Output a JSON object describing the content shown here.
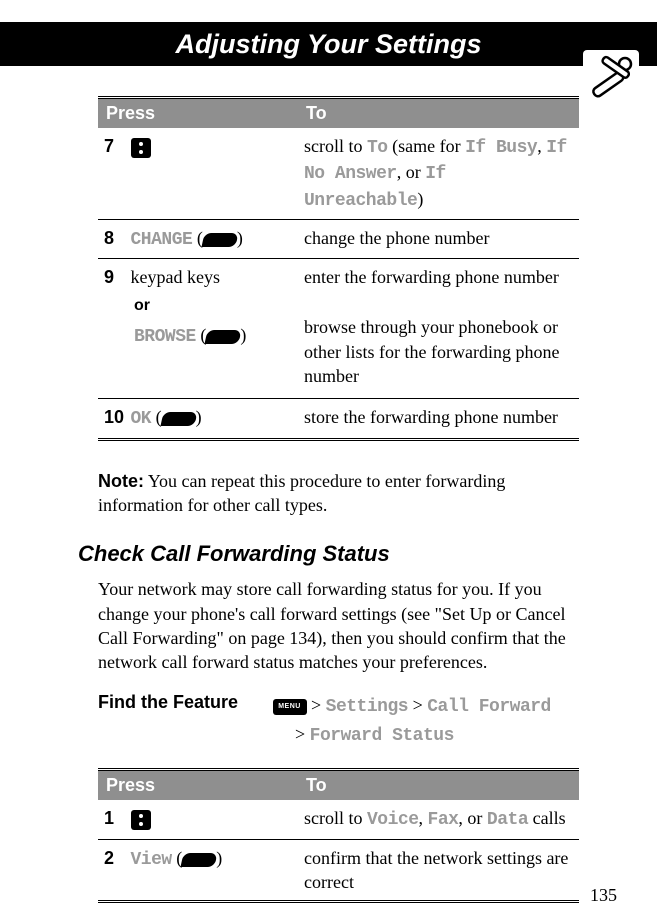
{
  "header": {
    "title": "Adjusting Your Settings"
  },
  "table1": {
    "head_press": "Press",
    "head_to": "To",
    "rows": {
      "r7": {
        "num": "7",
        "to_pre": "scroll to ",
        "to_a": "To",
        "to_mid1": " (same for ",
        "to_b": "If Busy",
        "to_mid2": ", ",
        "to_c": "If No Answer",
        "to_mid3": ", or ",
        "to_d": "If Unreachable",
        "to_post": ")"
      },
      "r8": {
        "num": "8",
        "label": "CHANGE",
        "paren_open": " (",
        "paren_close": ")",
        "to": "change the phone number"
      },
      "r9": {
        "num": "9",
        "press_a": "keypad keys",
        "or": "or",
        "label_b": "BROWSE",
        "paren_open": " (",
        "paren_close": ")",
        "to_a": "enter the forwarding phone number",
        "to_b": "browse through your phonebook or other lists for the forwarding phone number"
      },
      "r10": {
        "num": "10",
        "label": "OK",
        "paren_open": " (",
        "paren_close": ")",
        "to": "store the forwarding phone number"
      }
    }
  },
  "note": {
    "label": "Note:",
    "text": " You can repeat this procedure to enter forwarding information for other call types."
  },
  "section_heading": "Check Call Forwarding Status",
  "body_para": "Your network may store call forwarding status for you. If you change your phone's call forward settings (see \"Set Up or Cancel Call Forwarding\" on page 134), then you should confirm that the network call forward status matches your preferences.",
  "find_feature": {
    "label": "Find the Feature",
    "menu_key_text": "MENU",
    "sep": " > ",
    "p1": "Settings",
    "p2": "Call Forward",
    "p3": "Forward Status"
  },
  "table2": {
    "head_press": "Press",
    "head_to": "To",
    "rows": {
      "r1": {
        "num": "1",
        "to_pre": "scroll to ",
        "to_a": "Voice",
        "to_mid1": ", ",
        "to_b": "Fax",
        "to_mid2": ", or ",
        "to_c": "Data",
        "to_post": " calls"
      },
      "r2": {
        "num": "2",
        "label": "View",
        "paren_open": " (",
        "paren_close": ")",
        "to": "confirm that the network settings are correct"
      }
    }
  },
  "page_number": "135"
}
